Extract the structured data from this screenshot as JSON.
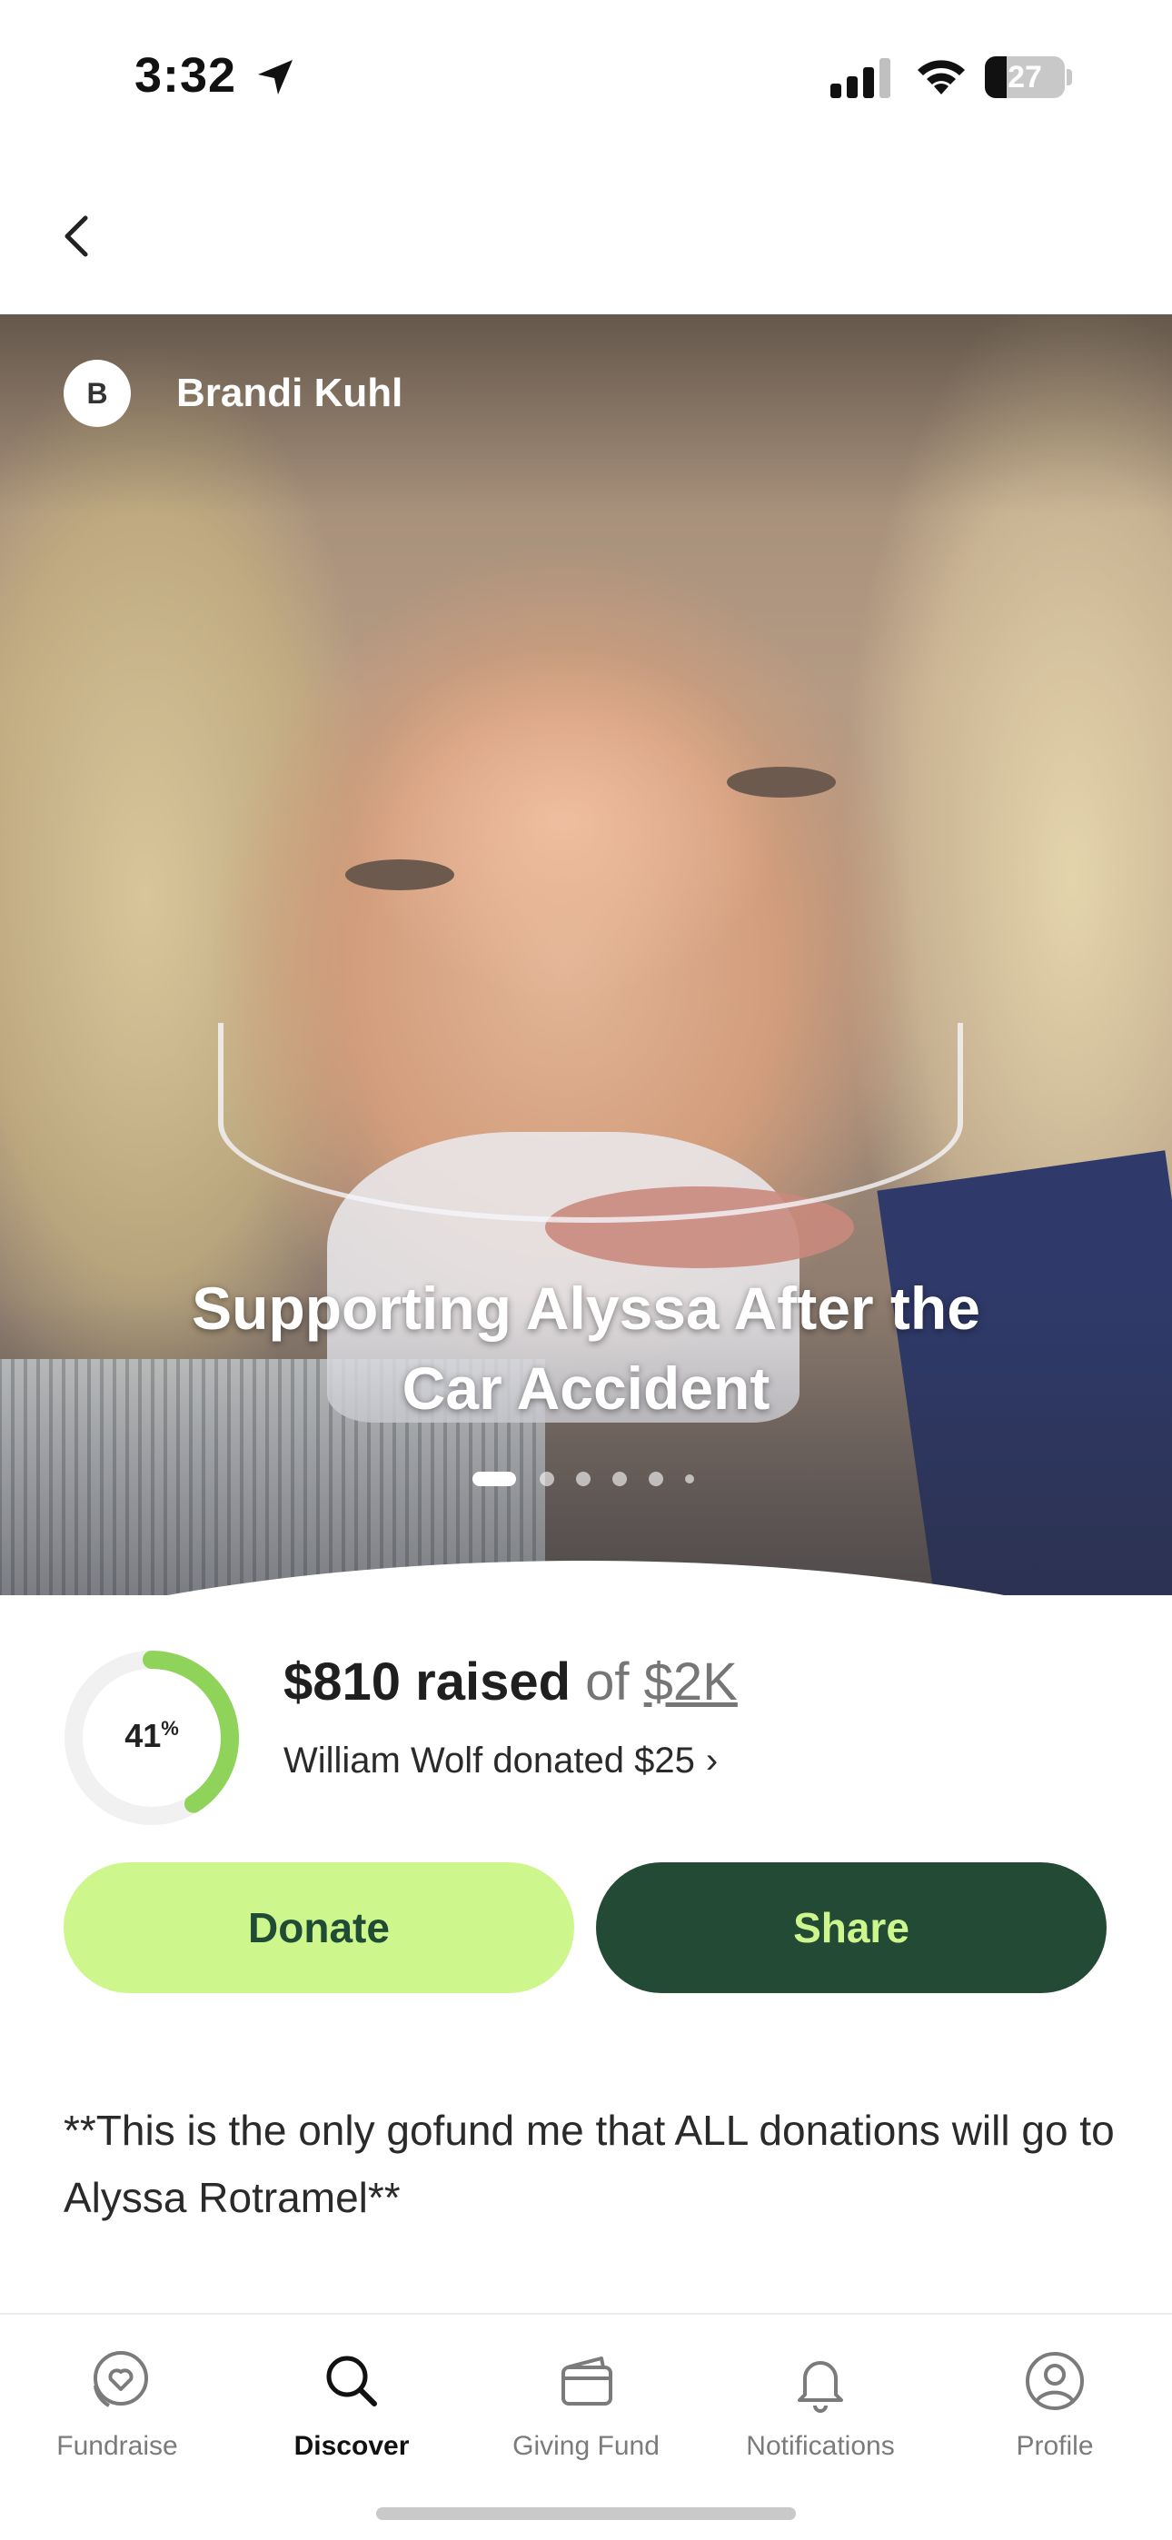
{
  "status_bar": {
    "time": "3:32",
    "battery": "27",
    "battery_level": 0.27
  },
  "campaign": {
    "organizer_initial": "B",
    "organizer_name": "Brandi Kuhl",
    "title": "Supporting Alyssa After the Car Accident",
    "gallery_count": 6,
    "gallery_active": 1
  },
  "progress": {
    "percent_value": 41,
    "percent_num": "41",
    "percent_sign": "%",
    "raised": "$810 raised",
    "of": "of",
    "goal": "$2K",
    "recent_donation": "William Wolf donated $25",
    "recent_chevron": "›"
  },
  "actions": {
    "donate": "Donate",
    "share": "Share"
  },
  "description": "**This is the only gofund me that ALL donations will go to Alyssa Rotramel**",
  "tabbar": {
    "items": [
      {
        "label": "Fundraise",
        "icon": "heart-ribbon-icon"
      },
      {
        "label": "Discover",
        "icon": "search-icon",
        "active": true
      },
      {
        "label": "Giving Fund",
        "icon": "wallet-icon"
      },
      {
        "label": "Notifications",
        "icon": "bell-icon"
      },
      {
        "label": "Profile",
        "icon": "profile-icon"
      }
    ]
  },
  "colors": {
    "accent_green": "#cdf78c",
    "dark_green": "#234a34",
    "ring_green": "#8fd35a"
  }
}
